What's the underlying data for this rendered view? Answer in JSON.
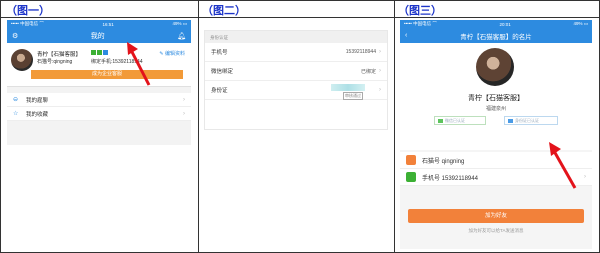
{
  "captions": [
    "（图一）",
    "（图二）",
    "（图三）"
  ],
  "panel1": {
    "status_left": "••••• 中国电信 ⌒",
    "status_time": "16:51",
    "status_right": "49% ▭",
    "nav_title": "我的",
    "name": "青柠【石猫客服】",
    "edit_label": "编辑资料",
    "account": "石猫号:qingning",
    "phone_bound": "绑定手机:15392118944",
    "orange_button": "成为企业客服",
    "rows": [
      {
        "label": "我的雇聊"
      },
      {
        "label": "我的收藏"
      }
    ]
  },
  "panel2": {
    "section_title": "身份认证",
    "rows": [
      {
        "label": "手机号",
        "value": "15392118944"
      },
      {
        "label": "微信绑定",
        "value": "已绑定"
      },
      {
        "label": "身份证",
        "value": "",
        "badge": "审核通过"
      }
    ]
  },
  "panel3": {
    "status_left": "••••• 中国电信 ⌒",
    "status_time": "20:01",
    "status_right": "49% ▭",
    "nav_title": "青柠【石猫客服】的名片",
    "name": "青柠【石猫客服】",
    "location": "福建泉州",
    "tag_wechat": "微信已认证",
    "tag_phone": "身份证已认证",
    "info_rows": [
      {
        "label": "石猫号 qingning"
      },
      {
        "label": "手机号 15392118944"
      }
    ],
    "add_button": "加为好友",
    "hint": "加为好友可以给TA发送消息"
  },
  "colors": {
    "caption": "#1d35c9",
    "nav_blue": "#2d8be0",
    "orange": "#f2813a",
    "arrow_red": "#e3131b"
  }
}
